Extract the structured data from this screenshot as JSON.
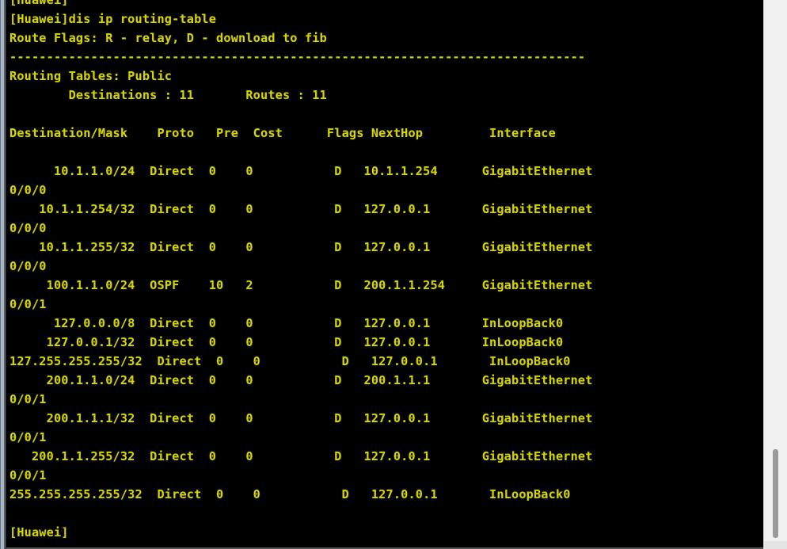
{
  "window": {
    "shell": "Huawei VRP CLI",
    "prompt": "[Huawei]",
    "command": "dis ip routing-table",
    "text_color": "#d4d400",
    "background_color": "#000000"
  },
  "scrollbar": {
    "orientation": "vertical",
    "thumb_position": "near-bottom"
  },
  "terminal": {
    "partial_top_line": "[Huawei]",
    "command_line": "[Huawei]dis ip routing-table",
    "route_flags_line": "Route Flags: R - relay, D - download to fib",
    "separator": "------------------------------------------------------------------------------",
    "tables_label": "Routing Tables: Public",
    "summary": {
      "destinations_label": "Destinations",
      "destinations_value": "11",
      "routes_label": "Routes",
      "routes_value": "11",
      "line": "        Destinations : 11       Routes : 11"
    },
    "columns": [
      "Destination/Mask",
      "Proto",
      "Pre",
      "Cost",
      "Flags",
      "NextHop",
      "Interface"
    ],
    "header_line": "Destination/Mask    Proto   Pre  Cost      Flags NextHop         Interface",
    "final_prompt": "[Huawei]",
    "routes": [
      {
        "destination": "10.1.1.0/24",
        "proto": "Direct",
        "pre": "0",
        "cost": "0",
        "flags": "D",
        "nexthop": "10.1.1.254",
        "interface": "GigabitEthernet0/0/0",
        "line": "      10.1.1.0/24  Direct  0    0           D   10.1.1.254      GigabitEthernet",
        "wrap": "0/0/0"
      },
      {
        "destination": "10.1.1.254/32",
        "proto": "Direct",
        "pre": "0",
        "cost": "0",
        "flags": "D",
        "nexthop": "127.0.0.1",
        "interface": "GigabitEthernet0/0/0",
        "line": "    10.1.1.254/32  Direct  0    0           D   127.0.0.1       GigabitEthernet",
        "wrap": "0/0/0"
      },
      {
        "destination": "10.1.1.255/32",
        "proto": "Direct",
        "pre": "0",
        "cost": "0",
        "flags": "D",
        "nexthop": "127.0.0.1",
        "interface": "GigabitEthernet0/0/0",
        "line": "    10.1.1.255/32  Direct  0    0           D   127.0.0.1       GigabitEthernet",
        "wrap": "0/0/0"
      },
      {
        "destination": "100.1.1.0/24",
        "proto": "OSPF",
        "pre": "10",
        "cost": "2",
        "flags": "D",
        "nexthop": "200.1.1.254",
        "interface": "GigabitEthernet0/0/1",
        "line": "     100.1.1.0/24  OSPF    10   2           D   200.1.1.254     GigabitEthernet",
        "wrap": "0/0/1"
      },
      {
        "destination": "127.0.0.0/8",
        "proto": "Direct",
        "pre": "0",
        "cost": "0",
        "flags": "D",
        "nexthop": "127.0.0.1",
        "interface": "InLoopBack0",
        "line": "      127.0.0.0/8  Direct  0    0           D   127.0.0.1       InLoopBack0",
        "wrap": ""
      },
      {
        "destination": "127.0.0.1/32",
        "proto": "Direct",
        "pre": "0",
        "cost": "0",
        "flags": "D",
        "nexthop": "127.0.0.1",
        "interface": "InLoopBack0",
        "line": "     127.0.0.1/32  Direct  0    0           D   127.0.0.1       InLoopBack0",
        "wrap": ""
      },
      {
        "destination": "127.255.255.255/32",
        "proto": "Direct",
        "pre": "0",
        "cost": "0",
        "flags": "D",
        "nexthop": "127.0.0.1",
        "interface": "InLoopBack0",
        "line": "127.255.255.255/32  Direct  0    0           D   127.0.0.1       InLoopBack0",
        "wrap": ""
      },
      {
        "destination": "200.1.1.0/24",
        "proto": "Direct",
        "pre": "0",
        "cost": "0",
        "flags": "D",
        "nexthop": "200.1.1.1",
        "interface": "GigabitEthernet0/0/1",
        "line": "     200.1.1.0/24  Direct  0    0           D   200.1.1.1       GigabitEthernet",
        "wrap": "0/0/1"
      },
      {
        "destination": "200.1.1.1/32",
        "proto": "Direct",
        "pre": "0",
        "cost": "0",
        "flags": "D",
        "nexthop": "127.0.0.1",
        "interface": "GigabitEthernet0/0/1",
        "line": "     200.1.1.1/32  Direct  0    0           D   127.0.0.1       GigabitEthernet",
        "wrap": "0/0/1"
      },
      {
        "destination": "200.1.1.255/32",
        "proto": "Direct",
        "pre": "0",
        "cost": "0",
        "flags": "D",
        "nexthop": "127.0.0.1",
        "interface": "GigabitEthernet0/0/1",
        "line": "   200.1.1.255/32  Direct  0    0           D   127.0.0.1       GigabitEthernet",
        "wrap": "0/0/1"
      },
      {
        "destination": "255.255.255.255/32",
        "proto": "Direct",
        "pre": "0",
        "cost": "0",
        "flags": "D",
        "nexthop": "127.0.0.1",
        "interface": "InLoopBack0",
        "line": "255.255.255.255/32  Direct  0    0           D   127.0.0.1       InLoopBack0",
        "wrap": ""
      }
    ]
  }
}
